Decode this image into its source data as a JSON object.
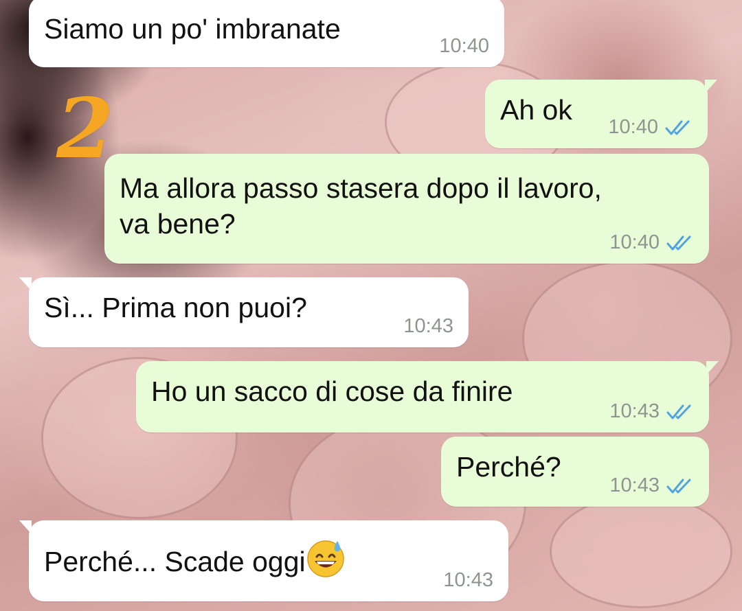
{
  "overlay_number": "2",
  "colors": {
    "incoming_bubble": "#ffffff",
    "outgoing_bubble": "#e8fcd8",
    "read_ticks": "#4fa3e0",
    "timestamp": "#8e948f",
    "overlay_number": "#f5a623"
  },
  "messages": [
    {
      "direction": "incoming",
      "text": "Siamo un po' imbranate",
      "time": "10:40"
    },
    {
      "direction": "outgoing",
      "text": "Ah ok",
      "time": "10:40",
      "status": "read-double-check-icon"
    },
    {
      "direction": "outgoing",
      "text_line1": "Ma allora passo stasera dopo il lavoro,",
      "text_line2": "va bene?",
      "time": "10:40",
      "status": "read-double-check-icon"
    },
    {
      "direction": "incoming",
      "text": "Sì... Prima non puoi?",
      "time": "10:43"
    },
    {
      "direction": "outgoing",
      "text": "Ho un sacco di cose da finire",
      "time": "10:43",
      "status": "read-double-check-icon"
    },
    {
      "direction": "outgoing",
      "text": "Perché?",
      "time": "10:43",
      "status": "read-double-check-icon"
    },
    {
      "direction": "incoming",
      "text": "Perché... Scade oggi",
      "emoji": "grinning-sweat-emoji",
      "time": "10:43"
    }
  ]
}
